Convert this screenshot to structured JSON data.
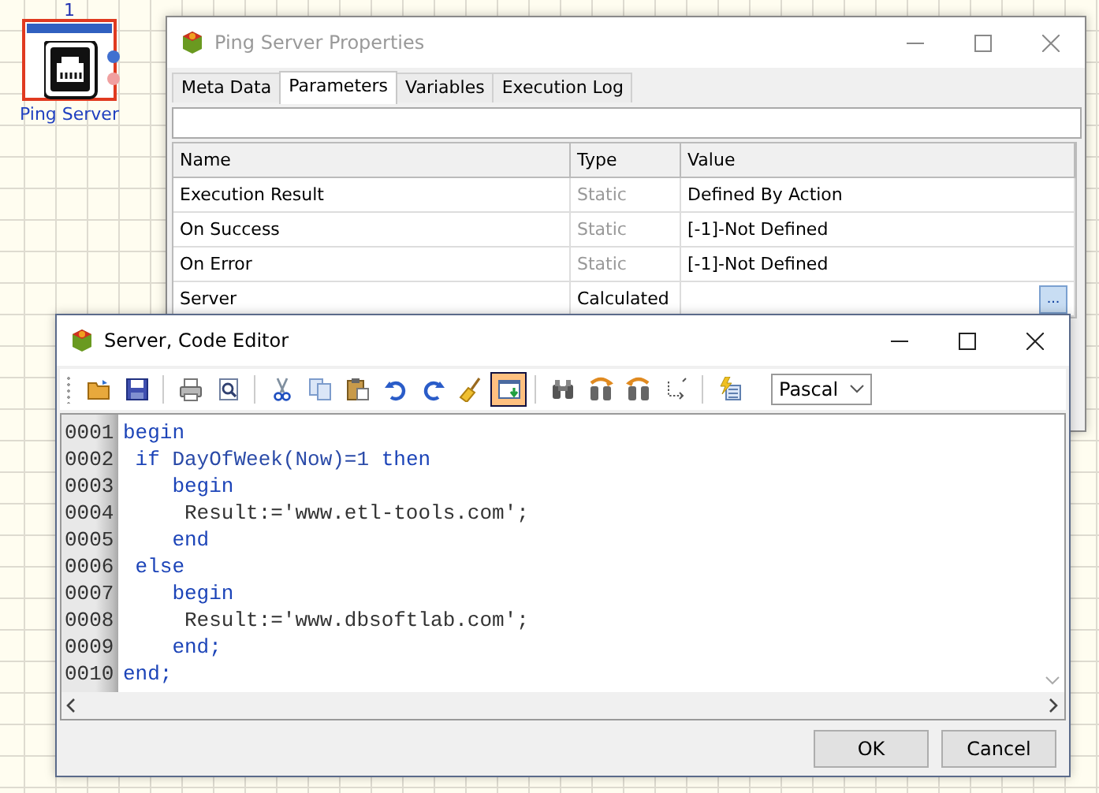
{
  "canvas": {
    "node": {
      "number": "1",
      "label": "Ping Server",
      "selected": true
    }
  },
  "properties_window": {
    "title": "Ping Server Properties",
    "active": false,
    "tabs": [
      {
        "label": "Meta Data",
        "selected": false
      },
      {
        "label": "Parameters",
        "selected": true
      },
      {
        "label": "Variables",
        "selected": false
      },
      {
        "label": "Execution Log",
        "selected": false
      }
    ],
    "table": {
      "columns": [
        "Name",
        "Type",
        "Value"
      ],
      "rows": [
        {
          "name": "Execution Result",
          "type": "Static",
          "dimmed": true,
          "value": "Defined By Action"
        },
        {
          "name": "On Success",
          "type": "Static",
          "dimmed": true,
          "value": "[-1]-Not Defined"
        },
        {
          "name": "On Error",
          "type": "Static",
          "dimmed": true,
          "value": "[-1]-Not Defined"
        },
        {
          "name": "Server",
          "type": "Calculated",
          "dimmed": false,
          "value_button": "..."
        }
      ]
    }
  },
  "code_editor": {
    "title": "Server, Code Editor",
    "active": true,
    "toolbar": [
      {
        "selected": false
      },
      {
        "selected": false
      },
      {
        "selected": false
      },
      {
        "selected": false
      },
      {
        "selected": false
      },
      {
        "selected": false
      },
      {
        "selected": false
      },
      {
        "selected": false
      },
      {
        "selected": false
      },
      {
        "selected": false
      },
      {
        "selected": true
      },
      {
        "selected": false
      },
      {
        "selected": false
      },
      {
        "selected": false
      },
      {
        "selected": false
      },
      {
        "selected": false
      }
    ],
    "language": "Pascal",
    "lines": [
      {
        "number": "0001",
        "segments": [
          {
            "text": "begin",
            "kind": "keyword"
          }
        ]
      },
      {
        "number": "0002",
        "segments": [
          {
            "text": " if",
            "kind": "keyword"
          },
          {
            "text": " DayOfWeek(Now)=1 ",
            "kind": "identifier"
          },
          {
            "text": "then",
            "kind": "keyword"
          }
        ]
      },
      {
        "number": "0003",
        "segments": [
          {
            "text": "    begin",
            "kind": "keyword"
          }
        ]
      },
      {
        "number": "0004",
        "segments": [
          {
            "text": "     Result:='www.etl-tools.com';",
            "kind": "text"
          }
        ]
      },
      {
        "number": "0005",
        "segments": [
          {
            "text": "    end",
            "kind": "keyword"
          }
        ]
      },
      {
        "number": "0006",
        "segments": [
          {
            "text": " else",
            "kind": "keyword"
          }
        ]
      },
      {
        "number": "0007",
        "segments": [
          {
            "text": "    begin",
            "kind": "keyword"
          }
        ]
      },
      {
        "number": "0008",
        "segments": [
          {
            "text": "     Result:='www.dbsoftlab.com';",
            "kind": "text"
          }
        ]
      },
      {
        "number": "0009",
        "segments": [
          {
            "text": "    end;",
            "kind": "keyword"
          }
        ]
      },
      {
        "number": "0010",
        "segments": [
          {
            "text": "end;",
            "kind": "keyword"
          }
        ]
      }
    ],
    "buttons": [
      "OK",
      "Cancel"
    ]
  }
}
